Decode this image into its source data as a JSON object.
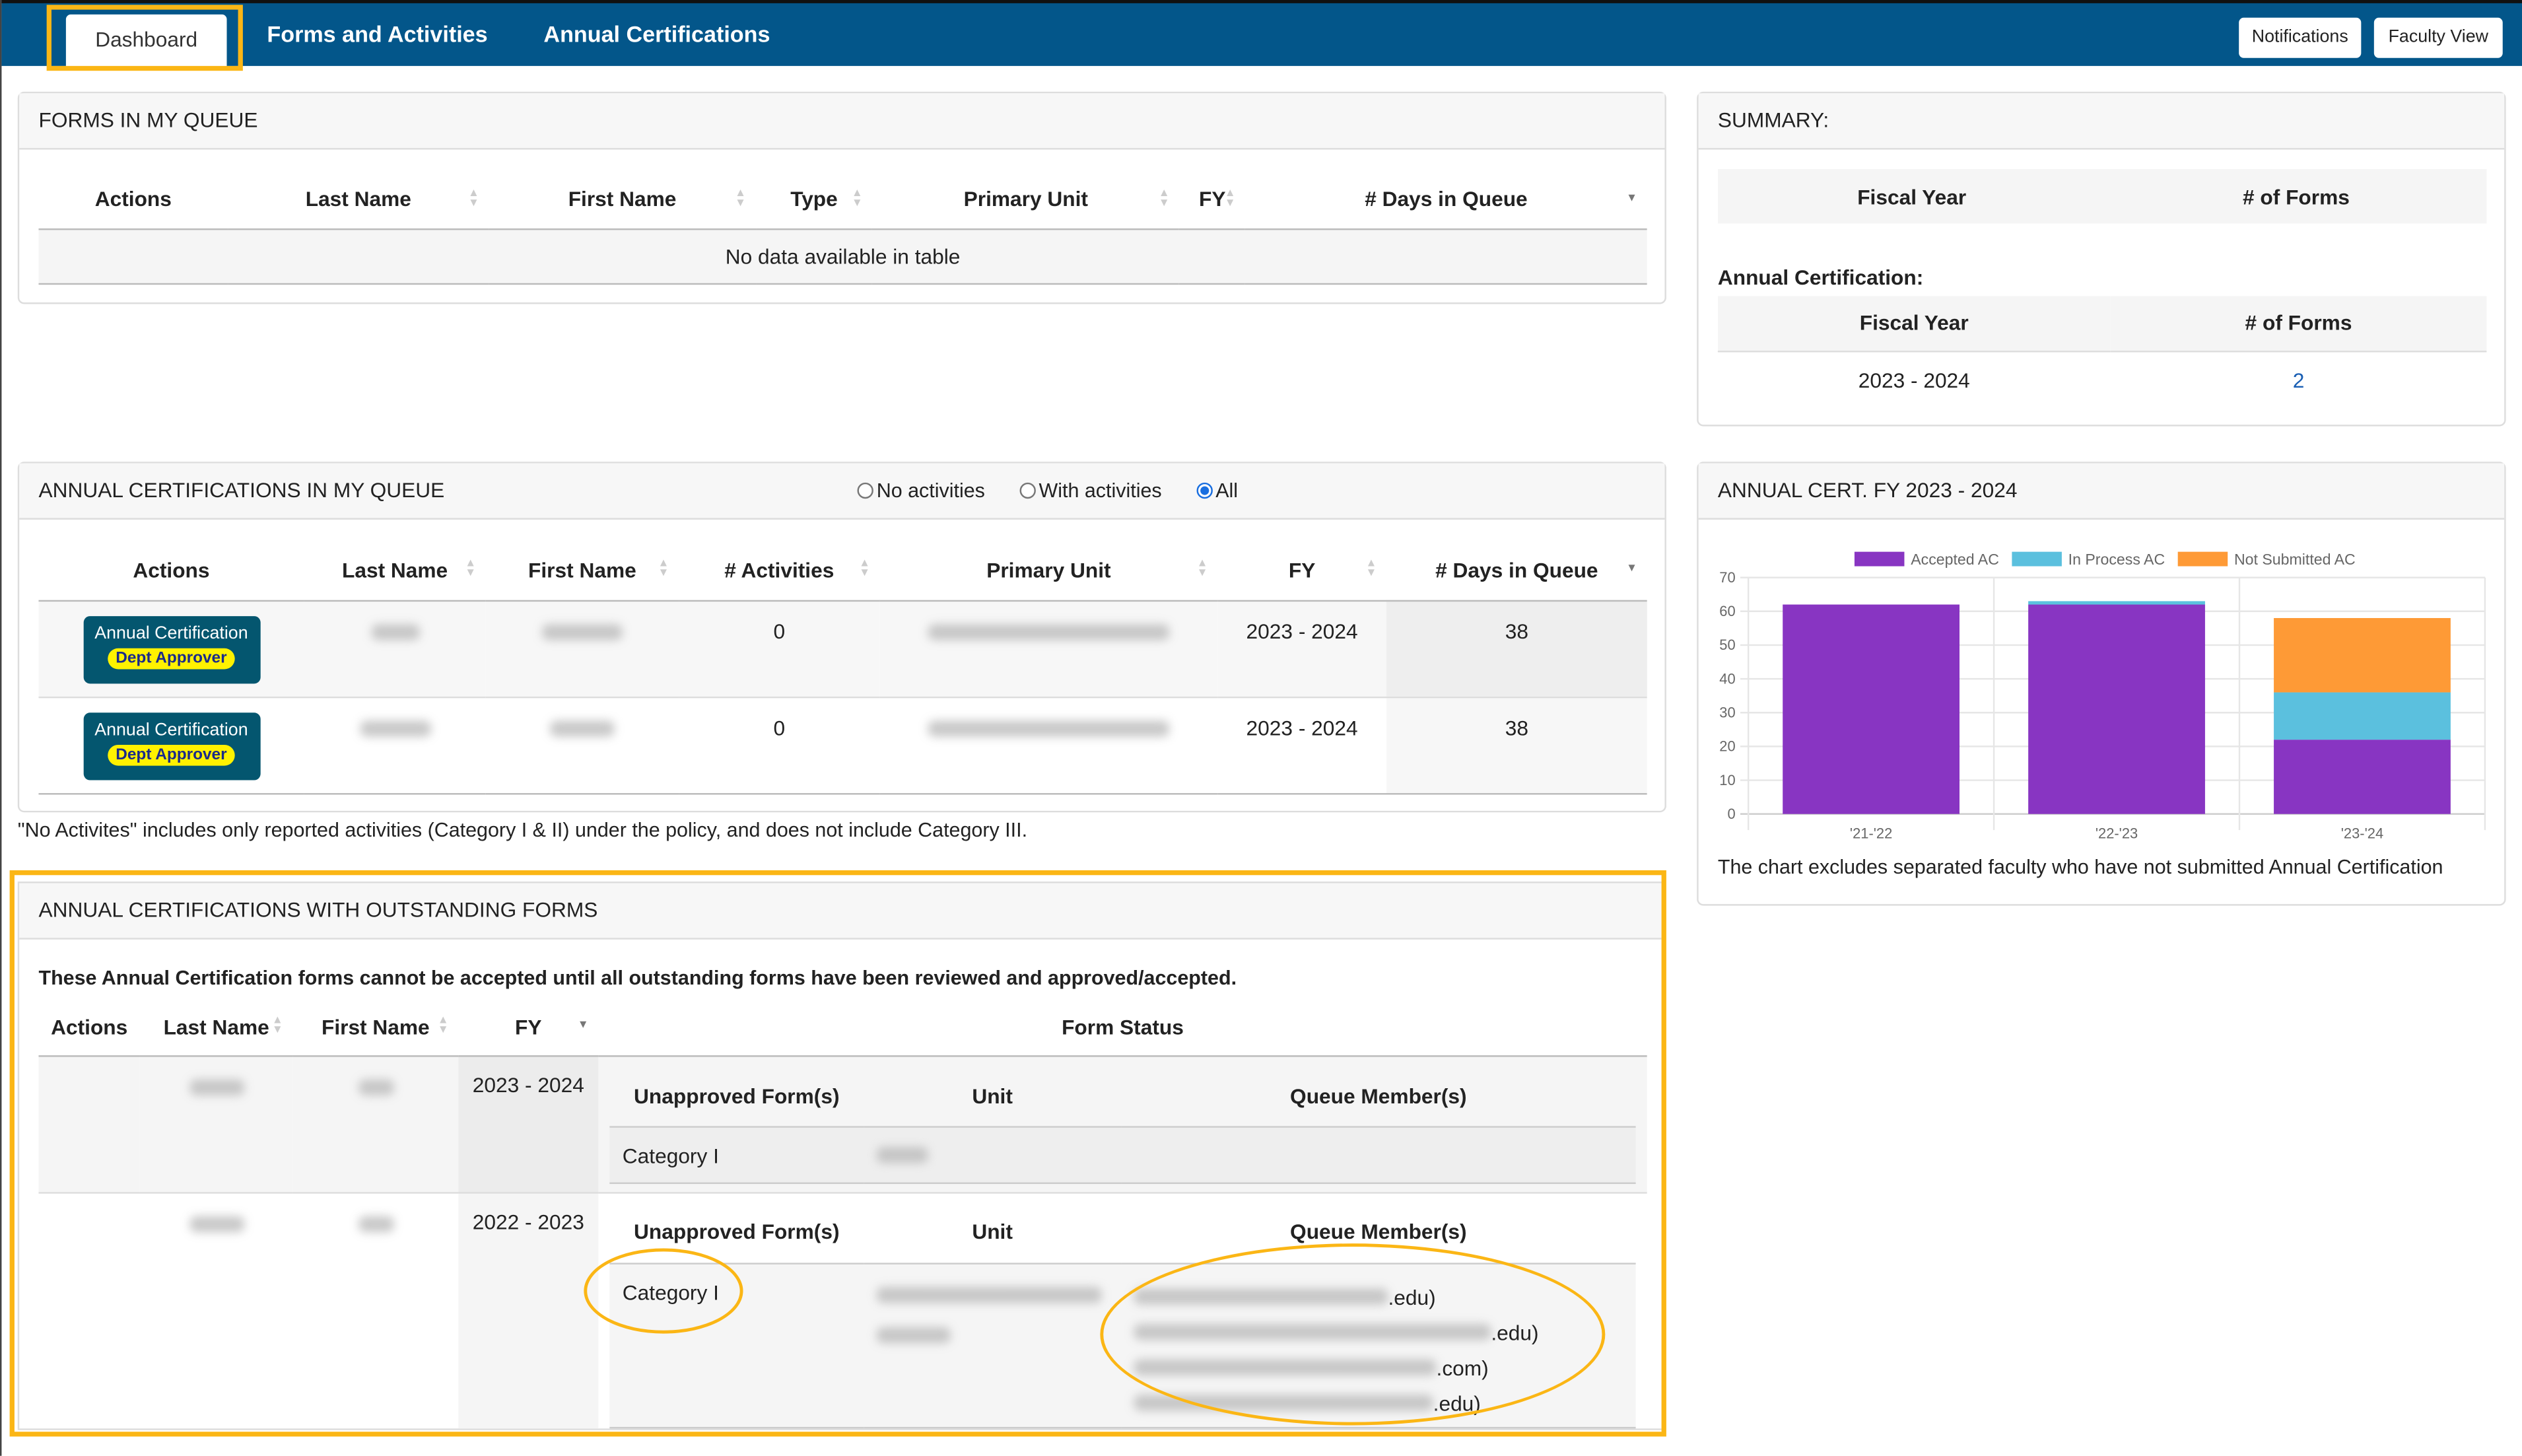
{
  "nav": {
    "tabs": [
      {
        "label": "Dashboard",
        "active": true
      },
      {
        "label": "Forms and Activities"
      },
      {
        "label": "Annual Certifications"
      }
    ],
    "notifications": "Notifications",
    "faculty_view": "Faculty View"
  },
  "forms_queue": {
    "title": "FORMS IN MY QUEUE",
    "columns": [
      "Actions",
      "Last Name",
      "First Name",
      "Type",
      "Primary Unit",
      "FY",
      "# Days in Queue"
    ],
    "empty": "No data available in table"
  },
  "summary": {
    "title": "SUMMARY:",
    "columns": [
      "Fiscal Year",
      "# of Forms"
    ],
    "ac_label": "Annual Certification:",
    "ac_columns": [
      "Fiscal Year",
      "# of Forms"
    ],
    "ac_rows": [
      {
        "fy": "2023 - 2024",
        "count": "2"
      }
    ]
  },
  "ac_queue": {
    "title": "ANNUAL CERTIFICATIONS IN MY QUEUE",
    "filters": [
      {
        "label": "No activities",
        "selected": false
      },
      {
        "label": "With activities",
        "selected": false
      },
      {
        "label": "All",
        "selected": true
      }
    ],
    "columns": [
      "Actions",
      "Last Name",
      "First Name",
      "# Activities",
      "Primary Unit",
      "FY",
      "# Days in Queue"
    ],
    "rows": [
      {
        "action": "Annual Certification",
        "badge": "Dept Approver",
        "activities": "0",
        "fy": "2023 - 2024",
        "days": "38"
      },
      {
        "action": "Annual Certification",
        "badge": "Dept Approver",
        "activities": "0",
        "fy": "2023 - 2024",
        "days": "38"
      }
    ],
    "note": "\"No Activites\" includes only reported activities (Category I & II) under the policy, and does not include Category III."
  },
  "outstanding": {
    "title": "ANNUAL CERTIFICATIONS WITH OUTSTANDING FORMS",
    "intro": "These Annual Certification forms cannot be accepted until all outstanding forms have been reviewed and approved/accepted.",
    "columns": [
      "Actions",
      "Last Name",
      "First Name",
      "FY",
      "Form Status"
    ],
    "inner_columns": [
      "Unapproved Form(s)",
      "Unit",
      "Queue Member(s)"
    ],
    "rows": [
      {
        "fy": "2023 - 2024",
        "forms": [
          {
            "form": "Category I",
            "members": []
          }
        ]
      },
      {
        "fy": "2022 - 2023",
        "forms": [
          {
            "form": "Category I",
            "members": [
              ".edu)",
              ".edu)",
              ".com)",
              ".edu)"
            ]
          }
        ]
      }
    ]
  },
  "chart_panel": {
    "title": "ANNUAL CERT. FY 2023 - 2024",
    "footnote": "The chart excludes separated faculty who have not submitted Annual Certification"
  },
  "chart_data": {
    "type": "bar",
    "stacked": true,
    "categories": [
      "'21-'22",
      "'22-'23",
      "'23-'24"
    ],
    "series": [
      {
        "name": "Accepted AC",
        "color": "#8835c2",
        "values": [
          62,
          62,
          22
        ]
      },
      {
        "name": "In Process AC",
        "color": "#5bc0de",
        "values": [
          0,
          1,
          14
        ]
      },
      {
        "name": "Not Submitted AC",
        "color": "#fe9a36",
        "values": [
          0,
          0,
          22
        ]
      }
    ],
    "ylim": [
      0,
      70
    ],
    "yticks": [
      0,
      10,
      20,
      30,
      40,
      50,
      60,
      70
    ],
    "grid": true,
    "legend": "top"
  },
  "colors": {
    "nav": "#03568a",
    "highlight": "#fbb615",
    "action_button": "#04566f",
    "badge": "#fff200"
  }
}
